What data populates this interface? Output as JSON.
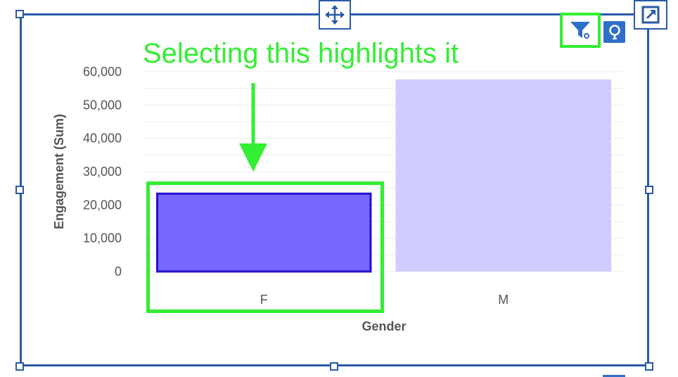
{
  "annotation": {
    "text": "Selecting this highlights it"
  },
  "toolbar": {
    "move_icon": "move-arrows-icon",
    "popout_icon": "popout-icon",
    "filter_icon": "filter-icon",
    "insight_icon": "lightbulb-icon"
  },
  "colors": {
    "frame": "#2a5aa8",
    "highlight": "#33ee33",
    "bar_selected": "#7766ff",
    "bar_selected_border": "#2211cc",
    "bar_unselected": "#d1ccff",
    "insight": "#2f6fc9"
  },
  "chart_data": {
    "type": "bar",
    "categories": [
      "F",
      "M"
    ],
    "values": [
      23700,
      57700
    ],
    "xlabel": "Gender",
    "ylabel": "Engagement (Sum)",
    "ylim": [
      0,
      60000
    ],
    "yticks": [
      "0",
      "10,000",
      "20,000",
      "30,000",
      "40,000",
      "50,000",
      "60,000"
    ],
    "selected": "F",
    "grid": true
  }
}
